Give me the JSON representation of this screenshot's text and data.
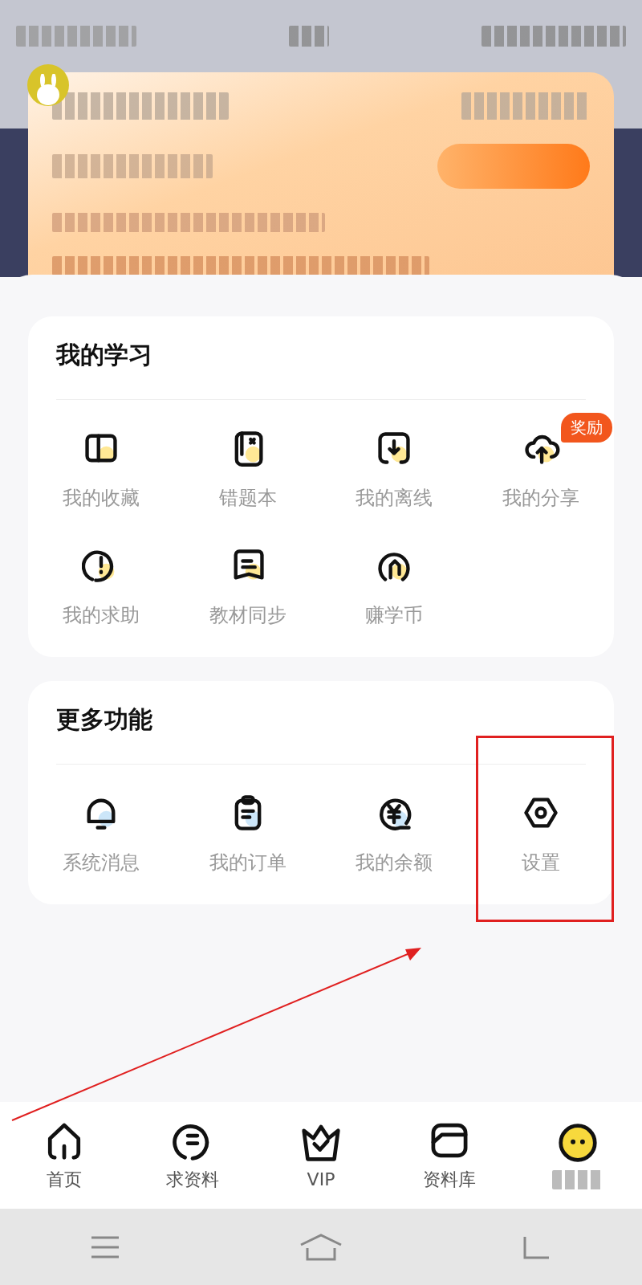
{
  "study": {
    "title": "我的学习",
    "items": [
      {
        "label": "我的收藏"
      },
      {
        "label": "错题本"
      },
      {
        "label": "我的离线"
      },
      {
        "label": "我的分享",
        "badge": "奖励"
      },
      {
        "label": "我的求助"
      },
      {
        "label": "教材同步"
      },
      {
        "label": "赚学币"
      }
    ]
  },
  "more": {
    "title": "更多功能",
    "items": [
      {
        "label": "系统消息",
        "highlighted": false
      },
      {
        "label": "我的订单",
        "highlighted": false
      },
      {
        "label": "我的余额",
        "highlighted": false
      },
      {
        "label": "设置",
        "highlighted": true
      }
    ]
  },
  "tab_bar": {
    "items": [
      {
        "kind": "icon",
        "label": "首页"
      },
      {
        "kind": "icon",
        "label": "求资料"
      },
      {
        "kind": "icon",
        "label": "VIP"
      },
      {
        "kind": "icon",
        "label": "资料库"
      },
      {
        "kind": "avatar"
      }
    ]
  }
}
